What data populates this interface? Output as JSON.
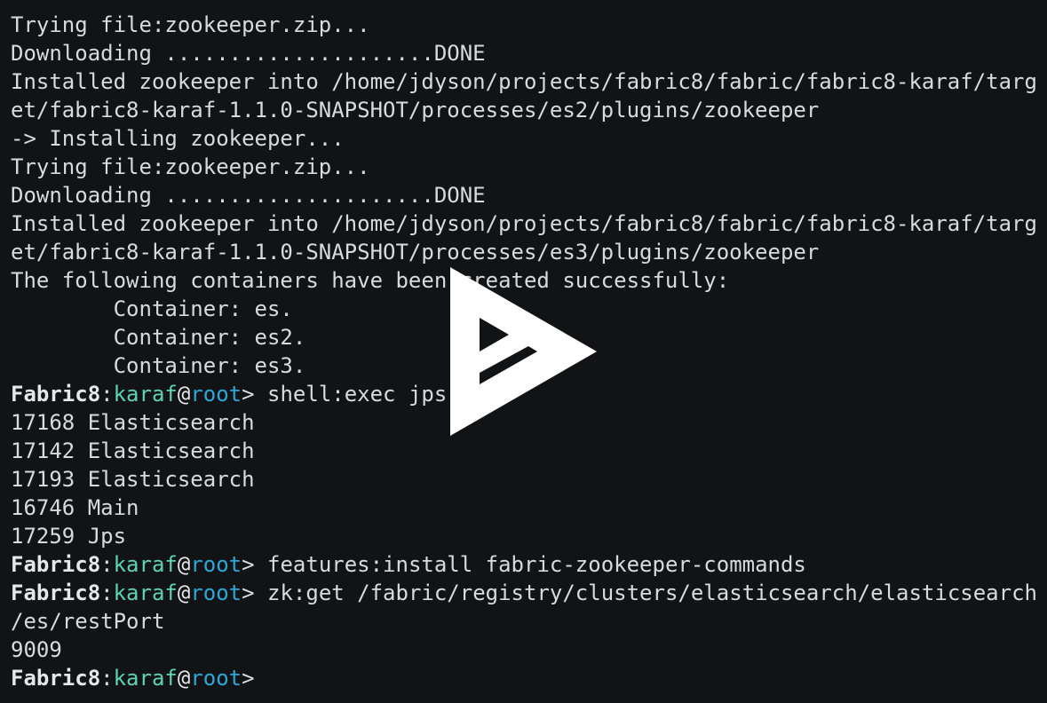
{
  "terminal": {
    "prompt": {
      "host": "Fabric8",
      "colon": ":",
      "user": "karaf",
      "at": "@",
      "root": "root",
      "gt": "> "
    },
    "lines": [
      {
        "type": "out",
        "text": "Trying file:zookeeper.zip..."
      },
      {
        "type": "out",
        "text": "Downloading .....................DONE"
      },
      {
        "type": "out",
        "text": "Installed zookeeper into /home/jdyson/projects/fabric8/fabric/fabric8-karaf/targ"
      },
      {
        "type": "out",
        "text": "et/fabric8-karaf-1.1.0-SNAPSHOT/processes/es2/plugins/zookeeper"
      },
      {
        "type": "out",
        "text": "-> Installing zookeeper..."
      },
      {
        "type": "out",
        "text": "Trying file:zookeeper.zip..."
      },
      {
        "type": "out",
        "text": "Downloading .....................DONE"
      },
      {
        "type": "out",
        "text": "Installed zookeeper into /home/jdyson/projects/fabric8/fabric/fabric8-karaf/targ"
      },
      {
        "type": "out",
        "text": "et/fabric8-karaf-1.1.0-SNAPSHOT/processes/es3/plugins/zookeeper"
      },
      {
        "type": "out",
        "text": "The following containers have been created successfully:"
      },
      {
        "type": "out",
        "text": "        Container: es."
      },
      {
        "type": "out",
        "text": "        Container: es2."
      },
      {
        "type": "out",
        "text": "        Container: es3."
      },
      {
        "type": "prompt",
        "text": "shell:exec jps"
      },
      {
        "type": "out",
        "text": "17168 Elasticsearch"
      },
      {
        "type": "out",
        "text": "17142 Elasticsearch"
      },
      {
        "type": "out",
        "text": "17193 Elasticsearch"
      },
      {
        "type": "out",
        "text": "16746 Main"
      },
      {
        "type": "out",
        "text": "17259 Jps"
      },
      {
        "type": "prompt",
        "text": "features:install fabric-zookeeper-commands"
      },
      {
        "type": "prompt",
        "text": "zk:get /fabric/registry/clusters/elasticsearch/elasticsearch"
      },
      {
        "type": "out",
        "text": "/es/restPort"
      },
      {
        "type": "out",
        "text": "9009"
      },
      {
        "type": "prompt",
        "text": ""
      }
    ]
  },
  "overlay": {
    "icon": "asciinema-play-icon",
    "color": "#ffffff"
  }
}
